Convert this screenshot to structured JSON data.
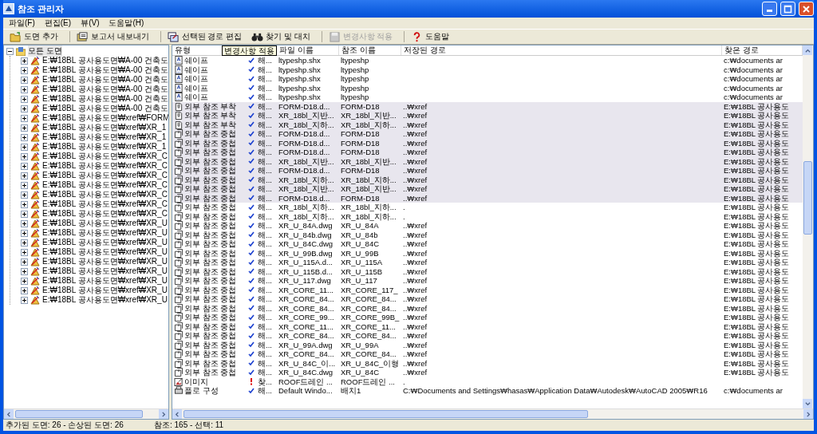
{
  "window": {
    "title": "참조 관리자"
  },
  "menu": [
    "파일(F)",
    "편집(E)",
    "뷰(V)",
    "도움말(H)"
  ],
  "toolbar": [
    {
      "kind": "add",
      "label": "도면 추가",
      "disabled": false
    },
    {
      "kind": "export",
      "label": "보고서 내보내기",
      "disabled": false
    },
    {
      "kind": "edit",
      "label": "선택된 경로 편집",
      "disabled": false
    },
    {
      "kind": "find",
      "label": "찾기 및 대치",
      "disabled": false
    },
    {
      "kind": "apply",
      "label": "변경사항 적용",
      "disabled": true
    },
    {
      "kind": "help",
      "label": "도움말",
      "disabled": false
    }
  ],
  "tooltip": "변경사항 적용",
  "tree": {
    "label": "모든 도면",
    "expanded": true,
    "children": [
      {
        "label": "E:₩18BL 공사용도면₩A-00 건축도",
        "expanded": false
      },
      {
        "label": "E:₩18BL 공사용도면₩A-00 건축도",
        "expanded": false
      },
      {
        "label": "E:₩18BL 공사용도면₩A-00 건축도",
        "expanded": false
      },
      {
        "label": "E:₩18BL 공사용도면₩A-00 건축도",
        "expanded": false
      },
      {
        "label": "E:₩18BL 공사용도면₩A-00 건축도",
        "expanded": false
      },
      {
        "label": "E:₩18BL 공사용도면₩A-00 건축도",
        "expanded": false
      },
      {
        "label": "E:₩18BL 공사용도면₩xref₩FORM",
        "expanded": false
      },
      {
        "label": "E:₩18BL 공사용도면₩xref₩XR_1",
        "expanded": false
      },
      {
        "label": "E:₩18BL 공사용도면₩xref₩XR_1",
        "expanded": false
      },
      {
        "label": "E:₩18BL 공사용도면₩xref₩XR_1",
        "expanded": false
      },
      {
        "label": "E:₩18BL 공사용도면₩xref₩XR_C",
        "expanded": false
      },
      {
        "label": "E:₩18BL 공사용도면₩xref₩XR_C",
        "expanded": false
      },
      {
        "label": "E:₩18BL 공사용도면₩xref₩XR_C",
        "expanded": false
      },
      {
        "label": "E:₩18BL 공사용도면₩xref₩XR_C",
        "expanded": false
      },
      {
        "label": "E:₩18BL 공사용도면₩xref₩XR_C",
        "expanded": false
      },
      {
        "label": "E:₩18BL 공사용도면₩xref₩XR_C",
        "expanded": false
      },
      {
        "label": "E:₩18BL 공사용도면₩xref₩XR_C",
        "expanded": false
      },
      {
        "label": "E:₩18BL 공사용도면₩xref₩XR_U",
        "expanded": false
      },
      {
        "label": "E:₩18BL 공사용도면₩xref₩XR_U",
        "expanded": false
      },
      {
        "label": "E:₩18BL 공사용도면₩xref₩XR_U",
        "expanded": false
      },
      {
        "label": "E:₩18BL 공사용도면₩xref₩XR_U",
        "expanded": false
      },
      {
        "label": "E:₩18BL 공사용도면₩xref₩XR_U",
        "expanded": false
      },
      {
        "label": "E:₩18BL 공사용도면₩xref₩XR_U",
        "expanded": false
      },
      {
        "label": "E:₩18BL 공사용도면₩xref₩XR_U",
        "expanded": false
      },
      {
        "label": "E:₩18BL 공사용도면₩xref₩XR_U",
        "expanded": false
      },
      {
        "label": "E:₩18BL 공사용도면₩xref₩XR_U",
        "expanded": false
      }
    ]
  },
  "table": {
    "columns": [
      "유형",
      "파일 이름",
      "참조 이름",
      "저장된 경로",
      "찾은 경로"
    ],
    "rows": [
      {
        "kind": "shape",
        "type": "쉐이프",
        "resolved": true,
        "status": "해...",
        "file": "ltypeshp.shx",
        "ref": "ltypeshp",
        "found": "c:₩documents ar",
        "selected": false
      },
      {
        "kind": "shape",
        "type": "쉐이프",
        "resolved": true,
        "status": "해...",
        "file": "ltypeshp.shx",
        "ref": "ltypeshp",
        "found": "c:₩documents ar",
        "selected": false
      },
      {
        "kind": "shape",
        "type": "쉐이프",
        "resolved": true,
        "status": "해...",
        "file": "ltypeshp.shx",
        "ref": "ltypeshp",
        "found": "c:₩documents ar",
        "selected": false
      },
      {
        "kind": "shape",
        "type": "쉐이프",
        "resolved": true,
        "status": "해...",
        "file": "ltypeshp.shx",
        "ref": "ltypeshp",
        "found": "c:₩documents ar",
        "selected": false
      },
      {
        "kind": "shape",
        "type": "쉐이프",
        "resolved": true,
        "status": "해...",
        "file": "ltypeshp.shx",
        "ref": "ltypeshp",
        "found": "c:₩documents ar",
        "selected": false
      },
      {
        "kind": "attach",
        "type": "외부 참조 부착",
        "resolved": true,
        "status": "해...",
        "file": "FORM-D18.d...",
        "ref": "FORM-D18",
        "saved": "..₩xref",
        "found": "E:₩18BL 공사용도",
        "selected": true
      },
      {
        "kind": "attach",
        "type": "외부 참조 부착",
        "resolved": true,
        "status": "해...",
        "file": "XR_18bl_지반...",
        "ref": "XR_18bl_지반...",
        "saved": "..₩xref",
        "found": "E:₩18BL 공사용도",
        "selected": true
      },
      {
        "kind": "attach",
        "type": "외부 참조 부착",
        "resolved": true,
        "status": "해...",
        "file": "XR_18bl_지하...",
        "ref": "XR_18bl_지하...",
        "saved": "..₩xref",
        "found": "E:₩18BL 공사용도",
        "selected": true
      },
      {
        "kind": "overlay",
        "type": "외부 참조 중첩",
        "resolved": true,
        "status": "해...",
        "file": "FORM-D18.d...",
        "ref": "FORM-D18",
        "saved": "..₩xref",
        "found": "E:₩18BL 공사용도",
        "selected": true
      },
      {
        "kind": "overlay",
        "type": "외부 참조 중첩",
        "resolved": true,
        "status": "해...",
        "file": "FORM-D18.d...",
        "ref": "FORM-D18",
        "saved": "..₩xref",
        "found": "E:₩18BL 공사용도",
        "selected": true
      },
      {
        "kind": "overlay",
        "type": "외부 참조 중첩",
        "resolved": true,
        "status": "해...",
        "file": "FORM-D18.d...",
        "ref": "FORM-D18",
        "saved": "..₩xref",
        "found": "E:₩18BL 공사용도",
        "selected": true
      },
      {
        "kind": "overlay",
        "type": "외부 참조 중첩",
        "resolved": true,
        "status": "해...",
        "file": "XR_18bl_지반...",
        "ref": "XR_18bl_지반...",
        "saved": "..₩xref",
        "found": "E:₩18BL 공사용도",
        "selected": true
      },
      {
        "kind": "overlay",
        "type": "외부 참조 중첩",
        "resolved": true,
        "status": "해...",
        "file": "FORM-D18.d...",
        "ref": "FORM-D18",
        "saved": "..₩xref",
        "found": "E:₩18BL 공사용도",
        "selected": true
      },
      {
        "kind": "overlay",
        "type": "외부 참조 중첩",
        "resolved": true,
        "status": "해...",
        "file": "XR_18bl_지하...",
        "ref": "XR_18bl_지하...",
        "saved": "..₩xref",
        "found": "E:₩18BL 공사용도",
        "selected": true
      },
      {
        "kind": "overlay",
        "type": "외부 참조 중첩",
        "resolved": true,
        "status": "해...",
        "file": "XR_18bl_지반...",
        "ref": "XR_18bl_지반...",
        "saved": "..₩xref",
        "found": "E:₩18BL 공사용도",
        "selected": true
      },
      {
        "kind": "overlay",
        "type": "외부 참조 중첩",
        "resolved": true,
        "status": "해...",
        "file": "FORM-D18.d...",
        "ref": "FORM-D18",
        "saved": "..₩xref",
        "found": "E:₩18BL 공사용도",
        "selected": true
      },
      {
        "kind": "overlay",
        "type": "외부 참조 중첩",
        "resolved": true,
        "status": "해...",
        "file": "XR_18bl_지하...",
        "ref": "XR_18bl_지하...",
        "saved": ".",
        "found": "E:₩18BL 공사용도",
        "selected": false
      },
      {
        "kind": "overlay",
        "type": "외부 참조 중첩",
        "resolved": true,
        "status": "해...",
        "file": "XR_18bl_지하...",
        "ref": "XR_18bl_지하...",
        "saved": ".",
        "found": "E:₩18BL 공사용도",
        "selected": false
      },
      {
        "kind": "overlay",
        "type": "외부 참조 중첩",
        "resolved": true,
        "status": "해...",
        "file": "XR_U_84A.dwg",
        "ref": "XR_U_84A",
        "saved": "..₩xref",
        "found": "E:₩18BL 공사용도",
        "selected": false
      },
      {
        "kind": "overlay",
        "type": "외부 참조 중첩",
        "resolved": true,
        "status": "해...",
        "file": "XR_U_84b.dwg",
        "ref": "XR_U_84b",
        "saved": "..₩xref",
        "found": "E:₩18BL 공사용도",
        "selected": false
      },
      {
        "kind": "overlay",
        "type": "외부 참조 중첩",
        "resolved": true,
        "status": "해...",
        "file": "XR_U_84C.dwg",
        "ref": "XR_U_84C",
        "saved": "..₩xref",
        "found": "E:₩18BL 공사용도",
        "selected": false
      },
      {
        "kind": "overlay",
        "type": "외부 참조 중첩",
        "resolved": true,
        "status": "해...",
        "file": "XR_U_99B.dwg",
        "ref": "XR_U_99B",
        "saved": "..₩xref",
        "found": "E:₩18BL 공사용도",
        "selected": false
      },
      {
        "kind": "overlay",
        "type": "외부 참조 중첩",
        "resolved": true,
        "status": "해...",
        "file": "XR_U_115A.d...",
        "ref": "XR_U_115A",
        "saved": "..₩xref",
        "found": "E:₩18BL 공사용도",
        "selected": false
      },
      {
        "kind": "overlay",
        "type": "외부 참조 중첩",
        "resolved": true,
        "status": "해...",
        "file": "XR_U_115B.d...",
        "ref": "XR_U_115B",
        "saved": "..₩xref",
        "found": "E:₩18BL 공사용도",
        "selected": false
      },
      {
        "kind": "overlay",
        "type": "외부 참조 중첩",
        "resolved": true,
        "status": "해...",
        "file": "XR_U_117.dwg",
        "ref": "XR_U_117",
        "saved": "..₩xref",
        "found": "E:₩18BL 공사용도",
        "selected": false
      },
      {
        "kind": "overlay",
        "type": "외부 참조 중첩",
        "resolved": true,
        "status": "해...",
        "file": "XR_CORE_11...",
        "ref": "XR_CORE_117_",
        "saved": "..₩xref",
        "found": "E:₩18BL 공사용도",
        "selected": false
      },
      {
        "kind": "overlay",
        "type": "외부 참조 중첩",
        "resolved": true,
        "status": "해...",
        "file": "XR_CORE_84...",
        "ref": "XR_CORE_84...",
        "saved": "..₩xref",
        "found": "E:₩18BL 공사용도",
        "selected": false
      },
      {
        "kind": "overlay",
        "type": "외부 참조 중첩",
        "resolved": true,
        "status": "해...",
        "file": "XR_CORE_84...",
        "ref": "XR_CORE_84...",
        "saved": "..₩xref",
        "found": "E:₩18BL 공사용도",
        "selected": false
      },
      {
        "kind": "overlay",
        "type": "외부 참조 중첩",
        "resolved": true,
        "status": "해...",
        "file": "XR_CORE_99...",
        "ref": "XR_CORE_99B_",
        "saved": "..₩xref",
        "found": "E:₩18BL 공사용도",
        "selected": false
      },
      {
        "kind": "overlay",
        "type": "외부 참조 중첩",
        "resolved": true,
        "status": "해...",
        "file": "XR_CORE_11...",
        "ref": "XR_CORE_11...",
        "saved": "..₩xref",
        "found": "E:₩18BL 공사용도",
        "selected": false
      },
      {
        "kind": "overlay",
        "type": "외부 참조 중첩",
        "resolved": true,
        "status": "해...",
        "file": "XR_CORE_84...",
        "ref": "XR_CORE_84...",
        "saved": "..₩xref",
        "found": "E:₩18BL 공사용도",
        "selected": false
      },
      {
        "kind": "overlay",
        "type": "외부 참조 중첩",
        "resolved": true,
        "status": "해...",
        "file": "XR_U_99A.dwg",
        "ref": "XR_U_99A",
        "saved": "..₩xref",
        "found": "E:₩18BL 공사용도",
        "selected": false
      },
      {
        "kind": "overlay",
        "type": "외부 참조 중첩",
        "resolved": true,
        "status": "해...",
        "file": "XR_CORE_84...",
        "ref": "XR_CORE_84...",
        "saved": "..₩xref",
        "found": "E:₩18BL 공사용도",
        "selected": false
      },
      {
        "kind": "overlay",
        "type": "외부 참조 중첩",
        "resolved": true,
        "status": "해...",
        "file": "XR_U_84C_이...",
        "ref": "XR_U_84C_이형",
        "saved": "..₩xref",
        "found": "E:₩18BL 공사용도",
        "selected": false
      },
      {
        "kind": "overlay",
        "type": "외부 참조 중첩",
        "resolved": true,
        "status": "해...",
        "file": "XR_U_84C.dwg",
        "ref": "XR_U_84C",
        "saved": "..₩xref",
        "found": "E:₩18BL 공사용도",
        "selected": false
      },
      {
        "kind": "image",
        "type": "이미지",
        "resolved": false,
        "status": "찾...",
        "file": "ROOF드레인 ...",
        "ref": "ROOF드레인 ...",
        "saved": ".",
        "selected": false
      },
      {
        "kind": "plot",
        "type": "플로 구성",
        "resolved": true,
        "status": "해...",
        "file": "Default Windo...",
        "ref": "배치1",
        "saved": "C:₩Documents and Settings₩hasas₩Application Data₩Autodesk₩AutoCAD 2005₩R16",
        "found": "c:₩documents ar",
        "selected": false
      }
    ]
  },
  "status_bar": {
    "left": "추가된 도면: 26 - 손상된 도면: 26",
    "right": "참조: 165 - 선택: 11"
  }
}
